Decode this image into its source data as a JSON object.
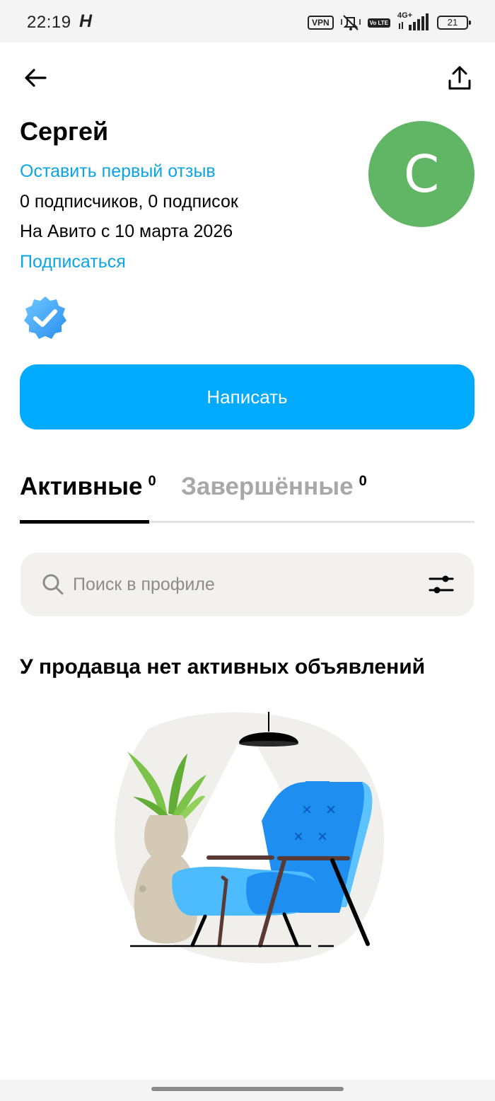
{
  "status_bar": {
    "time": "22:19",
    "app_indicator": "H",
    "vpn": "VPN",
    "volte": "Vo LTE",
    "network": "4G+",
    "battery": "21"
  },
  "icons": {
    "back": "arrow-left-icon",
    "share": "share-upload-icon",
    "verified": "verified-check-badge-icon",
    "search": "search-icon",
    "filter": "sliders-filter-icon"
  },
  "profile": {
    "name": "Сергей",
    "review_link": "Оставить первый отзыв",
    "followers": "0 подписчиков, 0 подписок",
    "since": "На Авито с 10 марта 2026",
    "subscribe_link": "Подписаться",
    "avatar_letter": "C",
    "avatar_color": "#61b665"
  },
  "actions": {
    "write_label": "Написать",
    "write_color": "#00aaff"
  },
  "tabs": [
    {
      "label": "Активные",
      "count": "0",
      "active": true
    },
    {
      "label": "Завершённые",
      "count": "0",
      "active": false
    }
  ],
  "search": {
    "placeholder": "Поиск в профиле",
    "value": ""
  },
  "empty_state": {
    "heading": "У продавца нет активных объявлений",
    "illustration": "armchair-lamp-plant-illustration"
  },
  "colors": {
    "link": "#0aa5e8",
    "tab_inactive": "#a8a8a8",
    "search_bg": "#f2f1ef"
  }
}
